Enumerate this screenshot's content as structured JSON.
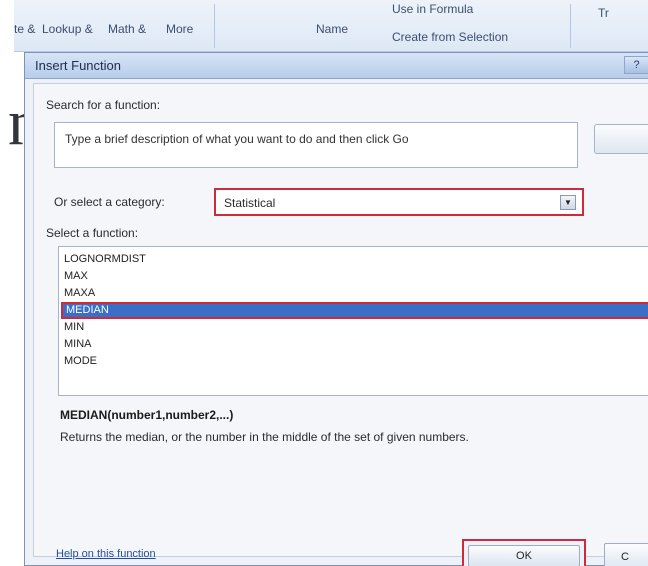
{
  "backdrop": {
    "slide_letter": "n",
    "ribbon": {
      "items": [
        {
          "label": "te &"
        },
        {
          "label": "Lookup &"
        },
        {
          "label": "Math &"
        },
        {
          "label": "More"
        },
        {
          "label": "Name"
        },
        {
          "label": "Use in Formula"
        },
        {
          "label": "Create from Selection"
        },
        {
          "label": "Tr"
        }
      ]
    }
  },
  "dialog": {
    "title": "Insert Function",
    "help_glyph": "?",
    "search": {
      "label": "Search for a function:",
      "value": "Type a brief description of what you want to do and then click Go"
    },
    "category": {
      "label": "Or select a category:",
      "value": "Statistical",
      "arrow": "▼"
    },
    "function_list": {
      "label": "Select a function:",
      "items": [
        "LOGNORMDIST",
        "MAX",
        "MAXA",
        "MEDIAN",
        "MIN",
        "MINA",
        "MODE"
      ],
      "selected": "MEDIAN"
    },
    "signature": "MEDIAN(number1,number2,...)",
    "description": "Returns the median, or the number in the middle of the set of given numbers.",
    "help_link": "Help on this function",
    "ok_label": "OK",
    "cancel_label": "C"
  },
  "colors": {
    "highlight_border": "#cc2b3b",
    "selection": "#3a6fc7"
  }
}
